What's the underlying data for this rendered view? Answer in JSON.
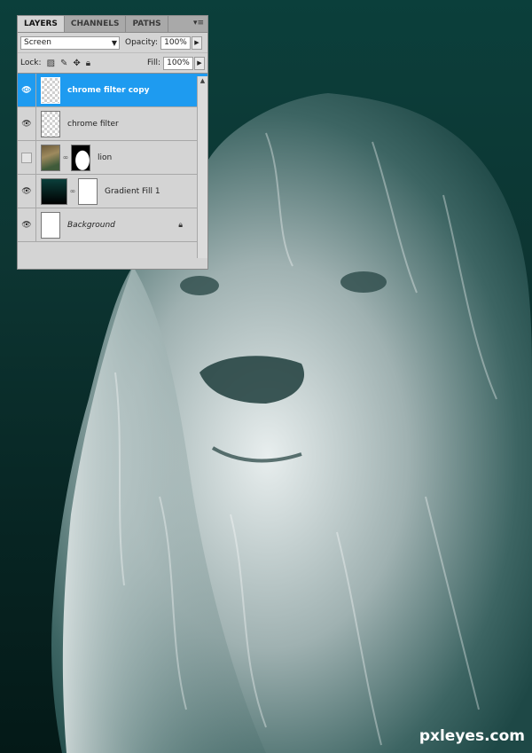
{
  "panel": {
    "tabs": [
      "LAYERS",
      "CHANNELS",
      "PATHS"
    ],
    "menu_icon": "panel-menu-icon",
    "blend_mode": "Screen",
    "opacity_label": "Opacity:",
    "opacity_value": "100%",
    "lock_label": "Lock:",
    "fill_label": "Fill:",
    "fill_value": "100%",
    "layers": [
      {
        "name": "chrome filter copy",
        "visible": true,
        "selected": true
      },
      {
        "name": "chrome filter",
        "visible": true,
        "selected": false
      },
      {
        "name": "lion",
        "visible": false,
        "selected": false
      },
      {
        "name": "Gradient Fill 1",
        "visible": true,
        "selected": false
      },
      {
        "name": "Background",
        "visible": true,
        "selected": false,
        "locked": true
      }
    ]
  },
  "watermark": "pxleyes.com",
  "colors": {
    "background_top": "#0b3f3b",
    "background_bottom": "#041917",
    "selection": "#1e9bf0"
  }
}
